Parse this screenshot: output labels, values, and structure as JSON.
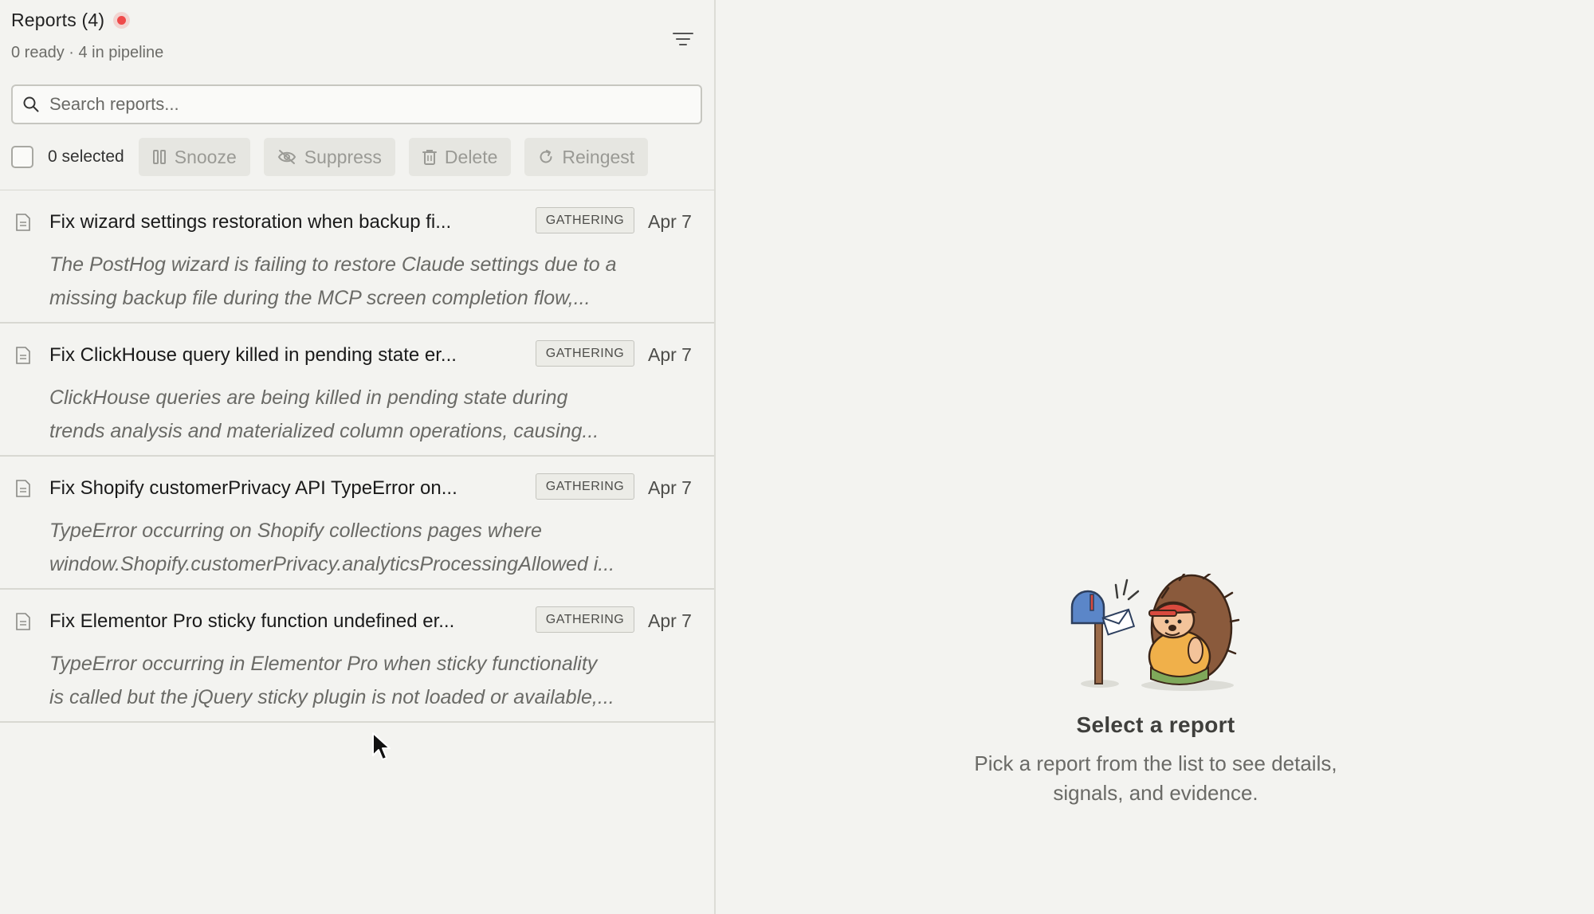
{
  "header": {
    "title": "Reports (4)",
    "subtitle": "0 ready · 4 in pipeline",
    "status_color": "#ef4a4a"
  },
  "search": {
    "placeholder": "Search reports...",
    "value": ""
  },
  "toolbar": {
    "selected_label": "0 selected",
    "snooze": "Snooze",
    "suppress": "Suppress",
    "delete": "Delete",
    "reingest": "Reingest"
  },
  "reports": [
    {
      "title": "Fix wizard settings restoration when backup fi...",
      "status": "GATHERING",
      "date": "Apr 7",
      "description": "The PostHog wizard is failing to restore Claude settings due to a\nmissing backup file during the MCP screen completion flow,..."
    },
    {
      "title": "Fix ClickHouse query killed in pending state er...",
      "status": "GATHERING",
      "date": "Apr 7",
      "description": "ClickHouse queries are being killed in pending state during\ntrends analysis and materialized column operations, causing..."
    },
    {
      "title": "Fix Shopify customerPrivacy API TypeError on...",
      "status": "GATHERING",
      "date": "Apr 7",
      "description": "TypeError occurring on Shopify collections pages where\nwindow.Shopify.customerPrivacy.analyticsProcessingAllowed i..."
    },
    {
      "title": "Fix Elementor Pro sticky function undefined er...",
      "status": "GATHERING",
      "date": "Apr 7",
      "description": "TypeError occurring in Elementor Pro when sticky functionality\nis called but the jQuery sticky plugin is not loaded or available,..."
    }
  ],
  "empty_state": {
    "title": "Select a report",
    "description": "Pick a report from the list to see details,\nsignals, and evidence.",
    "illustration_icon": "hedgehog-mailbox-illustration"
  },
  "icons": {
    "search": "search-icon",
    "filter": "filter-icon",
    "snooze": "pause-icon",
    "suppress": "eye-off-icon",
    "delete": "trash-icon",
    "reingest": "refresh-icon",
    "report": "document-icon"
  }
}
